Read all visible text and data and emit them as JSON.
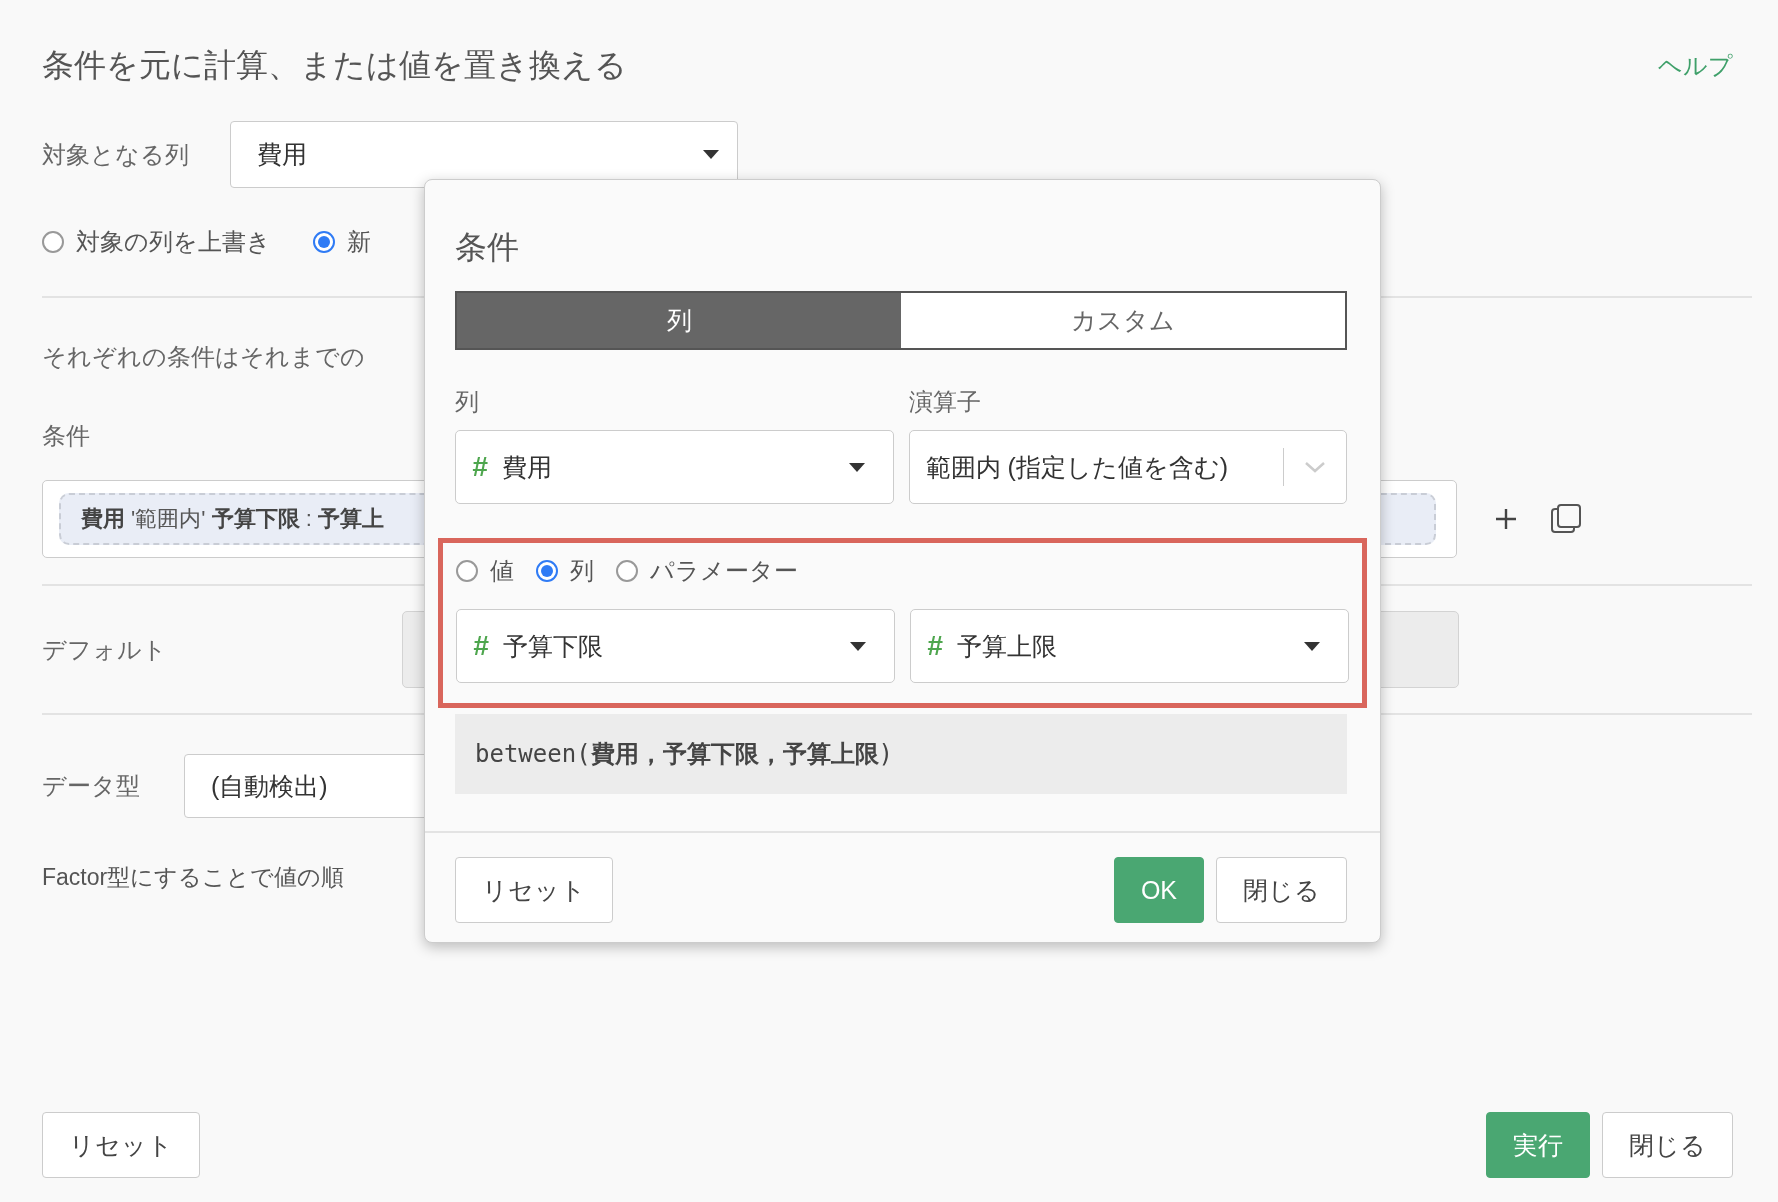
{
  "title": "条件を元に計算、または値を置き換える",
  "help_link": "ヘルプ",
  "target_column": {
    "label": "対象となる列",
    "value": "費用"
  },
  "output_mode": [
    {
      "label": "対象の列を上書き",
      "selected": false
    },
    {
      "label": "新",
      "selected": true
    }
  ],
  "description": "それぞれの条件はそれまでの",
  "conditions": {
    "label": "条件",
    "items": [
      {
        "text": "**費用** '範囲内' **予算下限** : **予算上**"
      }
    ]
  },
  "default": {
    "label": "デフォルト"
  },
  "data_type": {
    "label": "データ型",
    "value": "(自動検出)"
  },
  "note": "Factor型にすることで値の順",
  "footer_buttons": [
    {
      "label": "リセット",
      "kind": "secondary"
    },
    {
      "label": "実行",
      "kind": "primary"
    },
    {
      "label": "閉じる",
      "kind": "secondary"
    }
  ],
  "dialog": {
    "title": "条件",
    "tabs": [
      {
        "label": "列",
        "selected": true
      },
      {
        "label": "カスタム",
        "selected": false
      }
    ],
    "column": {
      "label": "列",
      "type_icon": "#",
      "value": "費用"
    },
    "operator": {
      "label": "演算子",
      "value": "範囲内 (指定した値を含む)"
    },
    "value_source": {
      "highlighted": true,
      "options": [
        {
          "label": "値",
          "selected": false
        },
        {
          "label": "列",
          "selected": true
        },
        {
          "label": "パラメーター",
          "selected": false
        }
      ]
    },
    "range": [
      {
        "type_icon": "#",
        "value": "予算下限"
      },
      {
        "type_icon": "#",
        "value": "予算上限"
      }
    ],
    "expression": "between(**費用，予算下限，予算上限**)",
    "buttons": [
      {
        "label": "リセット",
        "kind": "secondary"
      },
      {
        "label": "OK",
        "kind": "primary"
      },
      {
        "label": "閉じる",
        "kind": "secondary"
      }
    ]
  }
}
